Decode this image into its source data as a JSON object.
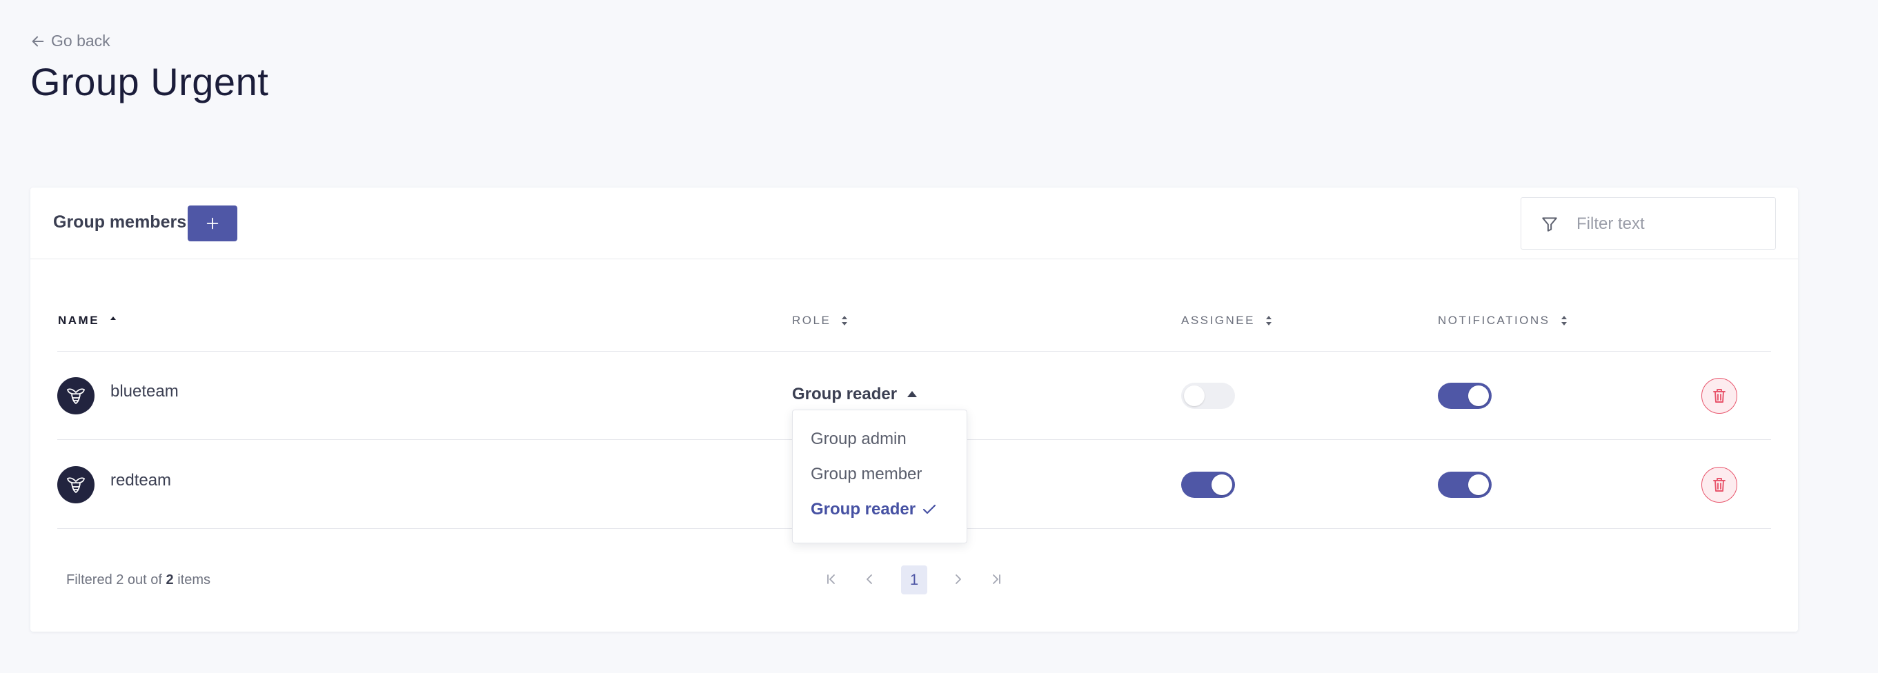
{
  "nav": {
    "back_label": "Go back"
  },
  "page": {
    "title": "Group Urgent"
  },
  "card": {
    "header_title": "Group members",
    "filter_placeholder": "Filter text"
  },
  "table": {
    "columns": [
      "NAME",
      "ROLE",
      "ASSIGNEE",
      "NOTIFICATIONS"
    ],
    "rows": [
      {
        "name": "blueteam",
        "role": "Group reader",
        "assignee": false,
        "notifications": true
      },
      {
        "name": "redteam",
        "role": "Group reader",
        "assignee": true,
        "notifications": true
      }
    ]
  },
  "role_dropdown": {
    "options": [
      "Group admin",
      "Group member",
      "Group reader"
    ],
    "selected": "Group reader"
  },
  "footer": {
    "filtered_prefix": "Filtered 2 out of ",
    "total": "2",
    "suffix": " items",
    "current_page": "1"
  },
  "colors": {
    "accent": "#4f57a6",
    "danger": "#e8556c",
    "background": "#f7f8fb"
  },
  "icons": [
    "arrow-left-icon",
    "plus-icon",
    "filter-icon",
    "sort-icon",
    "caret-up-icon",
    "check-icon",
    "trash-icon",
    "first-page-icon",
    "prev-page-icon",
    "next-page-icon",
    "last-page-icon",
    "bee-logo-icon"
  ]
}
